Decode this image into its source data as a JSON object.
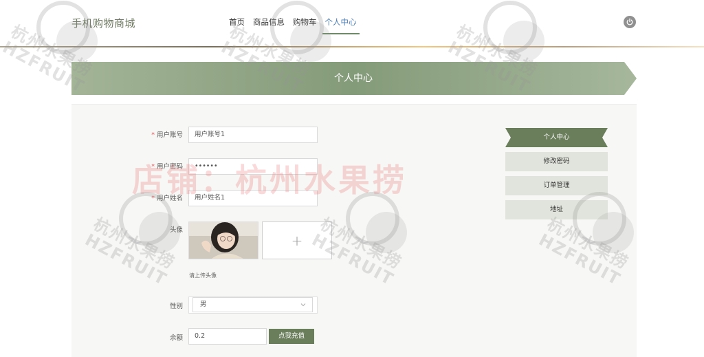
{
  "header": {
    "brand": "手机购物商城",
    "nav": [
      "首页",
      "商品信息",
      "购物车",
      "个人中心"
    ],
    "active_nav": "个人中心"
  },
  "banner": {
    "title": "个人中心"
  },
  "form": {
    "account_label": "用户账号",
    "account_value": "用户账号1",
    "password_label": "用户密码",
    "password_value": "••••••",
    "name_label": "用户姓名",
    "name_value": "用户姓名1",
    "avatar_label": "头像",
    "avatar_hint": "请上传头像",
    "upload_plus": "+",
    "gender_label": "性别",
    "gender_value": "男",
    "balance_label": "余额",
    "balance_value": "0.2",
    "recharge_button": "点我充值",
    "required_mark": "*"
  },
  "side_menu": [
    "个人中心",
    "修改密码",
    "订单管理",
    "地址"
  ],
  "watermark": {
    "center_text": "店铺：杭州水果捞",
    "stamp_cn": "杭州水果捞",
    "stamp_en": "HZFRUIT"
  },
  "colors": {
    "accent_green": "#6a7e5b",
    "nav_active": "#4d7fb5",
    "required": "#e25757"
  },
  "icons": [
    "power-icon",
    "chevron-down-icon",
    "plus-icon"
  ]
}
